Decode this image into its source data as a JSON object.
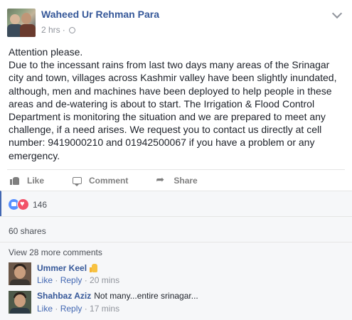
{
  "post": {
    "author": "Waheed Ur Rehman Para",
    "time": "2 hrs",
    "separator": "·",
    "text": "Attention please.\nDue to the incessant rains from last two days many areas of the Srinagar city and town, villages across Kashmir valley have been slightly inundated, although, men and machines have been deployed to help people in these areas and de-watering is about to start. The Irrigation & Flood Control Department is monitoring the situation and we are prepared to meet any challenge, if a need arises. We request you to contact us directly at cell number: 9419000210 and 01942500067 if you have a problem or any emergency."
  },
  "actions": {
    "like": "Like",
    "comment": "Comment",
    "share": "Share"
  },
  "reactions": {
    "count": "146",
    "icons": [
      "like-reaction-icon",
      "love-reaction-icon"
    ]
  },
  "shares": {
    "label": "60 shares"
  },
  "comments": {
    "view_more": "View 28 more comments",
    "items": [
      {
        "name": "Ummer Keel",
        "text": "",
        "has_thumb_emoji": true,
        "like": "Like",
        "reply": "Reply",
        "time": "20 mins"
      },
      {
        "name": "Shahbaz Aziz",
        "text": "Not many...entire srinagar...",
        "like": "Like",
        "reply": "Reply",
        "time": "17 mins"
      }
    ]
  },
  "colors": {
    "link": "#365899",
    "meta": "#90949c",
    "like_blue": "#5890ff",
    "love_red": "#f25268",
    "panel_bg": "#f6f7f9"
  }
}
